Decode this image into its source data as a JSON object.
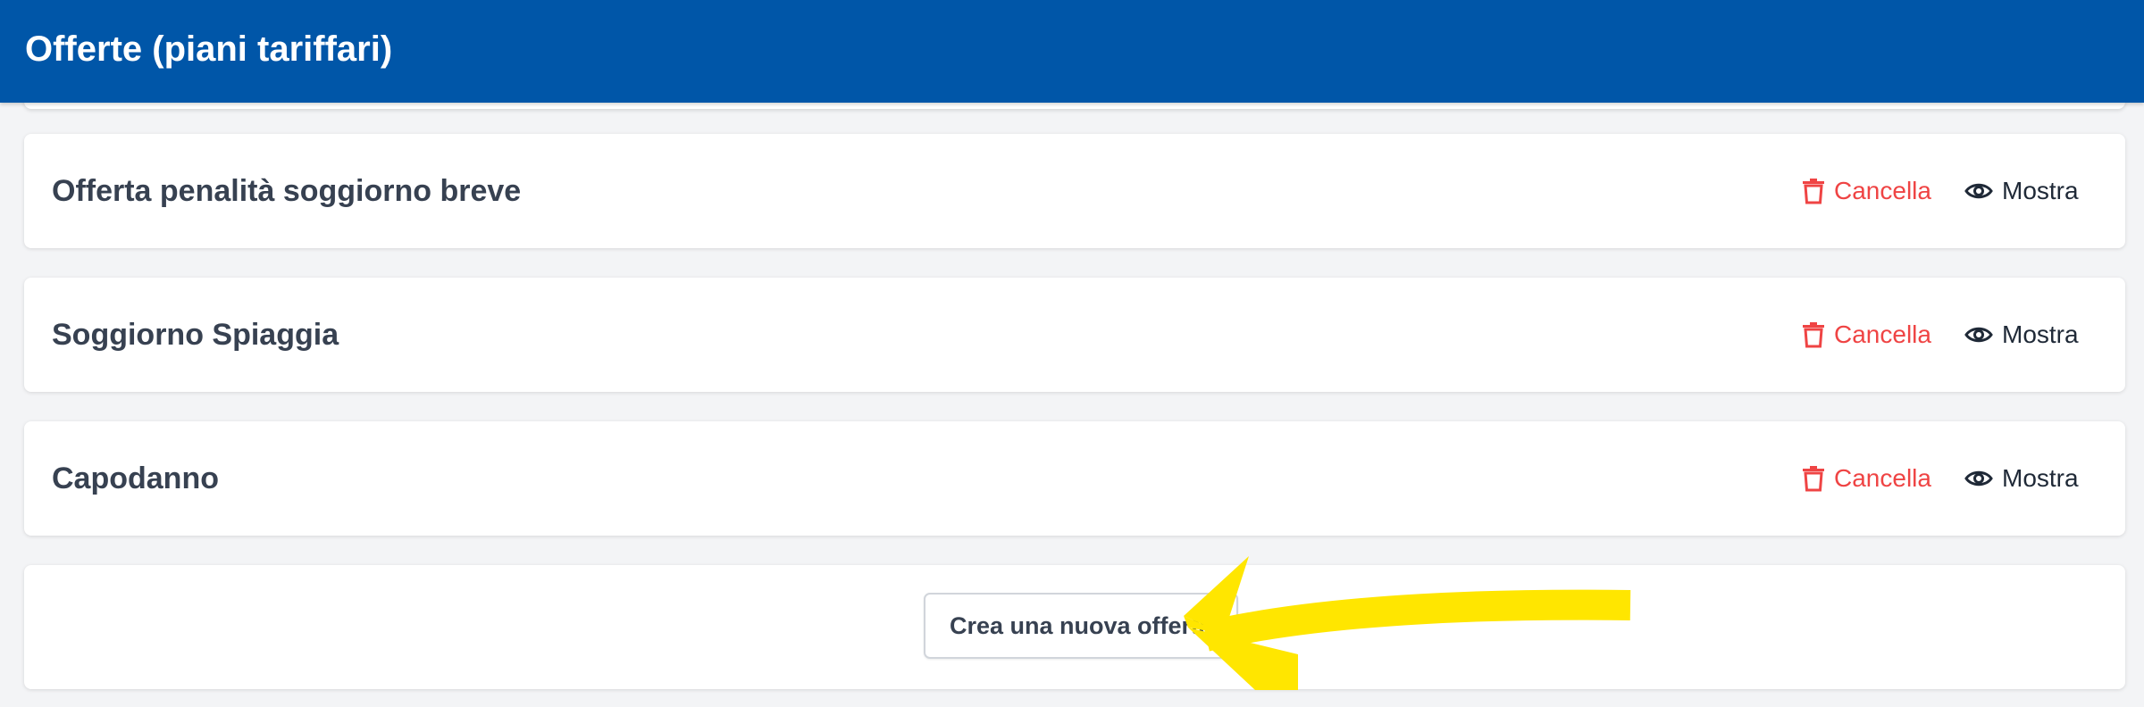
{
  "header": {
    "title": "Offerte (piani tariffari)"
  },
  "offers": [
    {
      "name": "Offerta penalità soggiorno breve",
      "delete_label": "Cancella",
      "show_label": "Mostra"
    },
    {
      "name": "Soggiorno Spiaggia",
      "delete_label": "Cancella",
      "show_label": "Mostra"
    },
    {
      "name": "Capodanno",
      "delete_label": "Cancella",
      "show_label": "Mostra"
    }
  ],
  "create": {
    "label": "Crea una nuova offerta"
  },
  "icons": {
    "delete": "trash-icon",
    "show": "eye-icon"
  },
  "colors": {
    "header_bg": "#0056a8",
    "delete": "#ef4444",
    "annotation": "#ffe600",
    "page_bg": "#f3f4f6"
  }
}
